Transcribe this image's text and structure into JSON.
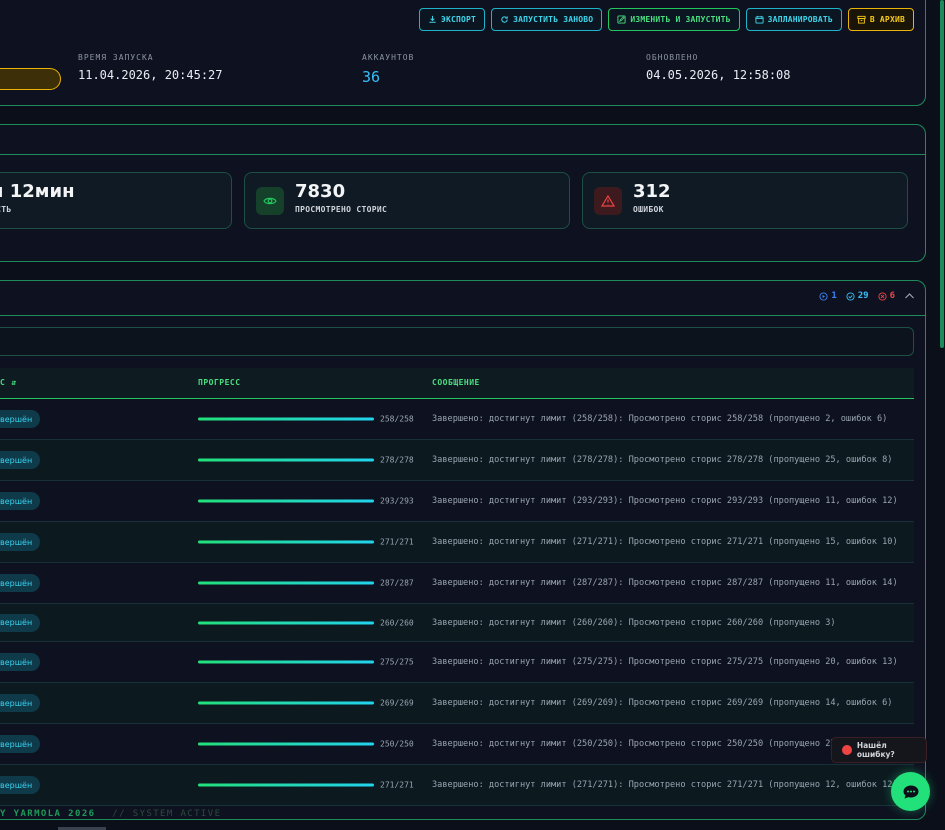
{
  "toolbar": {
    "export_label": "ЭКСПОРТ",
    "restart_label": "ЗАПУСТИТЬ ЗАНОВО",
    "edit_run_label": "ИЗМЕНИТЬ И ЗАПУСТИТЬ",
    "schedule_label": "ЗАПЛАНИРОВАТЬ",
    "archive_label": "В АРХИВ"
  },
  "info": {
    "start_label": "ВРЕМЯ ЗАПУСКА",
    "start_value": "11.04.2026, 20:45:27",
    "accounts_label": "АККАУНТОВ",
    "accounts_value": "36",
    "updated_label": "ОБНОВЛЕНО",
    "updated_value": "04.05.2026, 12:58:08"
  },
  "stats": {
    "duration_value": "н 12мин",
    "duration_label": "ОСТЬ",
    "stories_value": "7830",
    "stories_label": "ПРОСМОТРЕНО СТОРИС",
    "errors_value": "312",
    "errors_label": "ОШИБОК"
  },
  "counters": {
    "running": "1",
    "done": "29",
    "failed": "6"
  },
  "colors": {
    "accent": "#22e07a",
    "cyan": "#22d3ee",
    "error": "#ef4444",
    "warning": "#eab308"
  },
  "table": {
    "headers": {
      "status": "С",
      "progress": "ПРОГРЕСС",
      "message": "СООБЩЕНИЕ"
    },
    "rows": [
      {
        "status": "вершён",
        "progress": "258/258",
        "message": "Завершено: достигнут лимит (258/258): Просмотрено сторис 258/258 (пропущено 2, ошибок 6)"
      },
      {
        "status": "вершён",
        "progress": "278/278",
        "message": "Завершено: достигнут лимит (278/278): Просмотрено сторис 278/278 (пропущено 25, ошибок 8)"
      },
      {
        "status": "вершён",
        "progress": "293/293",
        "message": "Завершено: достигнут лимит (293/293): Просмотрено сторис 293/293 (пропущено 11, ошибок 12)"
      },
      {
        "status": "вершён",
        "progress": "271/271",
        "message": "Завершено: достигнут лимит (271/271): Просмотрено сторис 271/271 (пропущено 15, ошибок 10)"
      },
      {
        "status": "вершён",
        "progress": "287/287",
        "message": "Завершено: достигнут лимит (287/287): Просмотрено сторис 287/287 (пропущено 11, ошибок 14)"
      },
      {
        "status": "вершён",
        "progress": "260/260",
        "message": "Завершено: достигнут лимит (260/260): Просмотрено сторис 260/260 (пропущено 3)"
      },
      {
        "status": "вершён",
        "progress": "275/275",
        "message": "Завершено: достигнут лимит (275/275): Просмотрено сторис 275/275 (пропущено 20, ошибок 13)"
      },
      {
        "status": "вершён",
        "progress": "269/269",
        "message": "Завершено: достигнут лимит (269/269): Просмотрено сторис 269/269 (пропущено 14, ошибок 6)"
      },
      {
        "status": "вершён",
        "progress": "250/250",
        "message": "Завершено: достигнут лимит (250/250): Просмотрено сторис 250/250 (пропущено 27, ошибок 11)"
      },
      {
        "status": "вершён",
        "progress": "271/271",
        "message": "Завершено: достигнут лимит (271/271): Просмотрено сторис 271/271 (пропущено 12, ошибок 12)"
      }
    ]
  },
  "footer": {
    "brand": "Y YARMOLA 2026",
    "status": "// SYSTEM ACTIVE"
  },
  "bug_report": {
    "label": "Нашёл ошибку?"
  }
}
